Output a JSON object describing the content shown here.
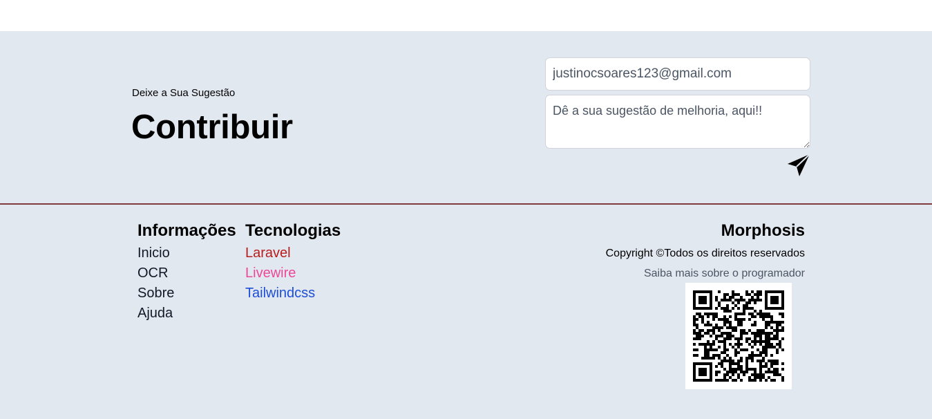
{
  "contribute": {
    "kicker": "Deixe a Sua Sugestão",
    "title": "Contribuir",
    "email_value": "justinocsoares123@gmail.com",
    "suggestion_placeholder": "Dê a sua sugestão de melhoria, aqui!!",
    "send_icon": "paper-plane-icon"
  },
  "footer": {
    "info": {
      "heading": "Informações",
      "links": [
        "Inicio",
        "OCR",
        "Sobre",
        "Ajuda"
      ]
    },
    "tech": {
      "heading": "Tecnologias",
      "links": [
        {
          "label": "Laravel",
          "color": "#b91c1c"
        },
        {
          "label": "Livewire",
          "color": "#ec4899"
        },
        {
          "label": "Tailwindcss",
          "color": "#1d4ed8"
        }
      ]
    },
    "brand": "Morphosis",
    "copyright": "Copyright ©Todos os direitos reservados",
    "more_link": "Saiba mais sobre o programador",
    "qr_icon": "qr-code-icon"
  },
  "colors": {
    "background": "#e2e8f0",
    "divider": "#7f3b3b"
  }
}
